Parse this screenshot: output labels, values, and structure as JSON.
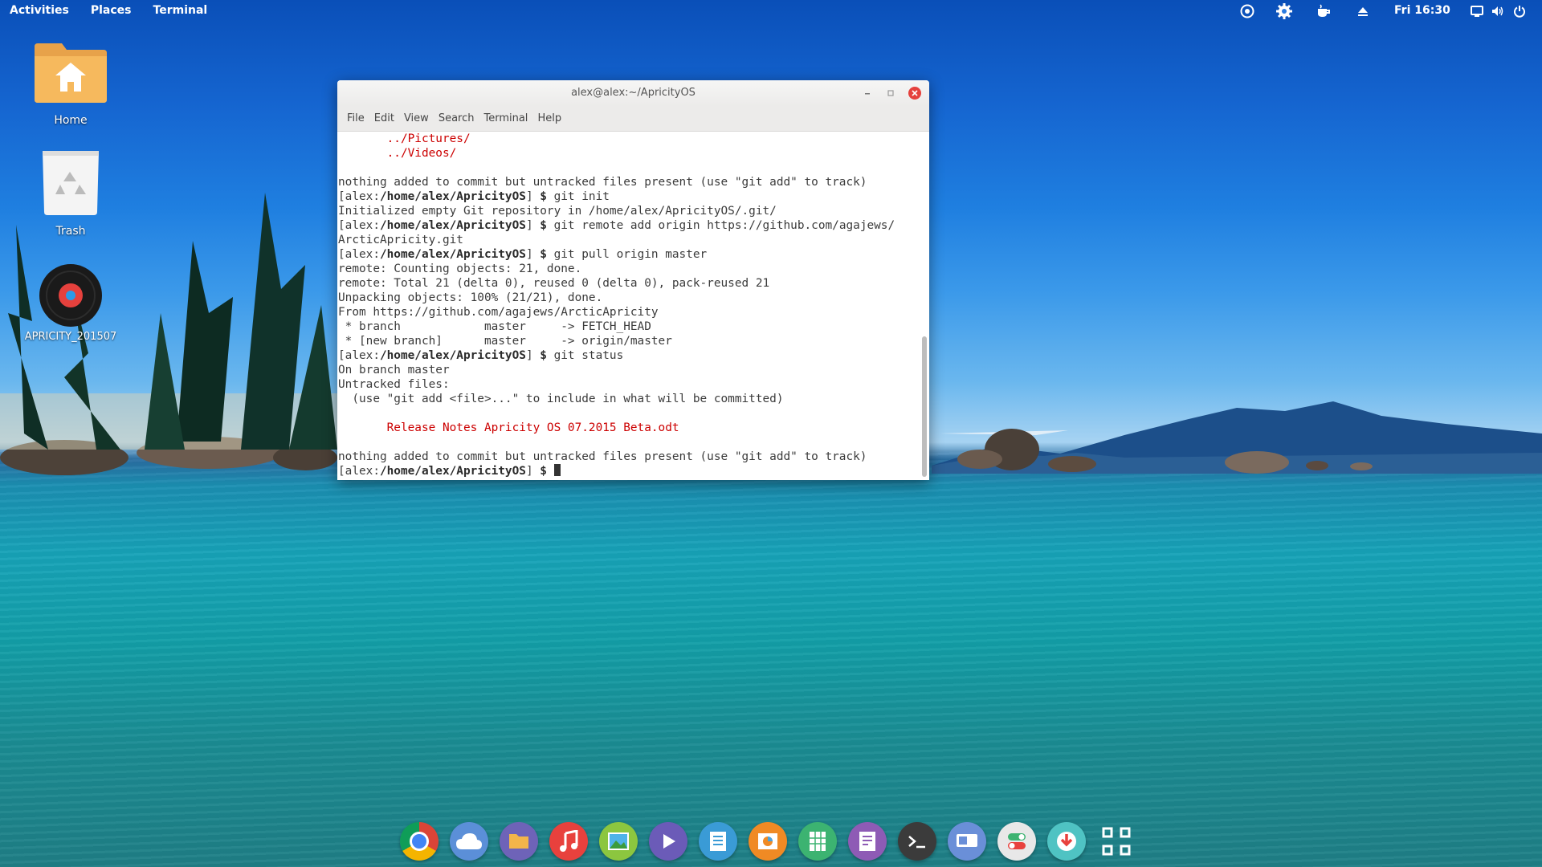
{
  "topbar": {
    "activities": "Activities",
    "places": "Places",
    "app": "Terminal",
    "clock": "Fri 16:30",
    "tray_icons": [
      "chat-icon",
      "settings-gear-icon",
      "coffee-cup-icon",
      "eject-icon",
      "screen-icon",
      "volume-icon",
      "power-icon"
    ]
  },
  "desktop": {
    "home_label": "Home",
    "trash_label": "Trash",
    "disc_label": "APRICITY_201507"
  },
  "window": {
    "title": "alex@alex:~/ApricityOS",
    "menu": [
      "File",
      "Edit",
      "View",
      "Search",
      "Terminal",
      "Help"
    ]
  },
  "terminal": {
    "prompt_user": "[alex:",
    "prompt_path": "/home/alex/ApricityOS",
    "prompt_end": "] ",
    "prompt_sign": "$",
    "lines": {
      "l1": "       ../Pictures/",
      "l2": "       ../Videos/",
      "l3": "",
      "l4": "nothing added to commit but untracked files present (use \"git add\" to track)",
      "l5_cmd": " git init",
      "l6": "Initialized empty Git repository in /home/alex/ApricityOS/.git/",
      "l7_cmd": " git remote add origin https://github.com/agajews/",
      "l8": "ArcticApricity.git",
      "l9_cmd": " git pull origin master",
      "l10": "remote: Counting objects: 21, done.",
      "l11": "remote: Total 21 (delta 0), reused 0 (delta 0), pack-reused 21",
      "l12": "Unpacking objects: 100% (21/21), done.",
      "l13": "From https://github.com/agajews/ArcticApricity",
      "l14": " * branch            master     -> FETCH_HEAD",
      "l15": " * [new branch]      master     -> origin/master",
      "l16_cmd": " git status",
      "l17": "On branch master",
      "l18": "Untracked files:",
      "l19": "  (use \"git add <file>...\" to include in what will be committed)",
      "l20": "",
      "l21": "       Release Notes Apricity OS 07.2015 Beta.odt",
      "l22": "",
      "l23": "nothing added to commit but untracked files present (use \"git add\" to track)"
    }
  },
  "dock": {
    "items": [
      "chrome-icon",
      "cloud-icon",
      "files-icon",
      "music-icon",
      "photos-icon",
      "video-icon",
      "document-icon",
      "presentation-icon",
      "spreadsheet-icon",
      "notes-icon",
      "terminal-icon",
      "display-icon",
      "settings-toggle-icon",
      "download-icon",
      "app-grid-icon"
    ]
  },
  "colors": {
    "terminal_red": "#cc0000",
    "close_button": "#e5413d"
  }
}
